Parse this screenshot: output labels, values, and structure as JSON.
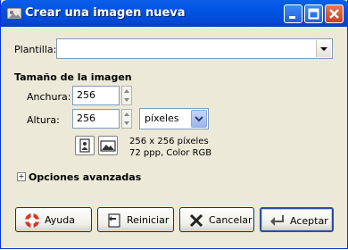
{
  "window": {
    "title": "Crear una imagen nueva"
  },
  "template": {
    "label": "Plantilla:",
    "value": ""
  },
  "image_size": {
    "heading": "Tamaño de la imagen",
    "width_label": "Anchura:",
    "width_value": "256",
    "height_label": "Altura:",
    "height_value": "256",
    "unit": "píxeles",
    "info_line1": "256 x 256 píxeles",
    "info_line2": "72 ppp, Color RGB"
  },
  "advanced": {
    "label": "Opciones avanzadas",
    "expander": "+"
  },
  "buttons": {
    "help": "Ayuda",
    "reset": "Reiniciar",
    "cancel": "Cancelar",
    "ok": "Aceptar"
  },
  "colors": {
    "titlebar": "#0054e3",
    "dialog_bg": "#ece9d8",
    "border": "#7f9db9"
  }
}
